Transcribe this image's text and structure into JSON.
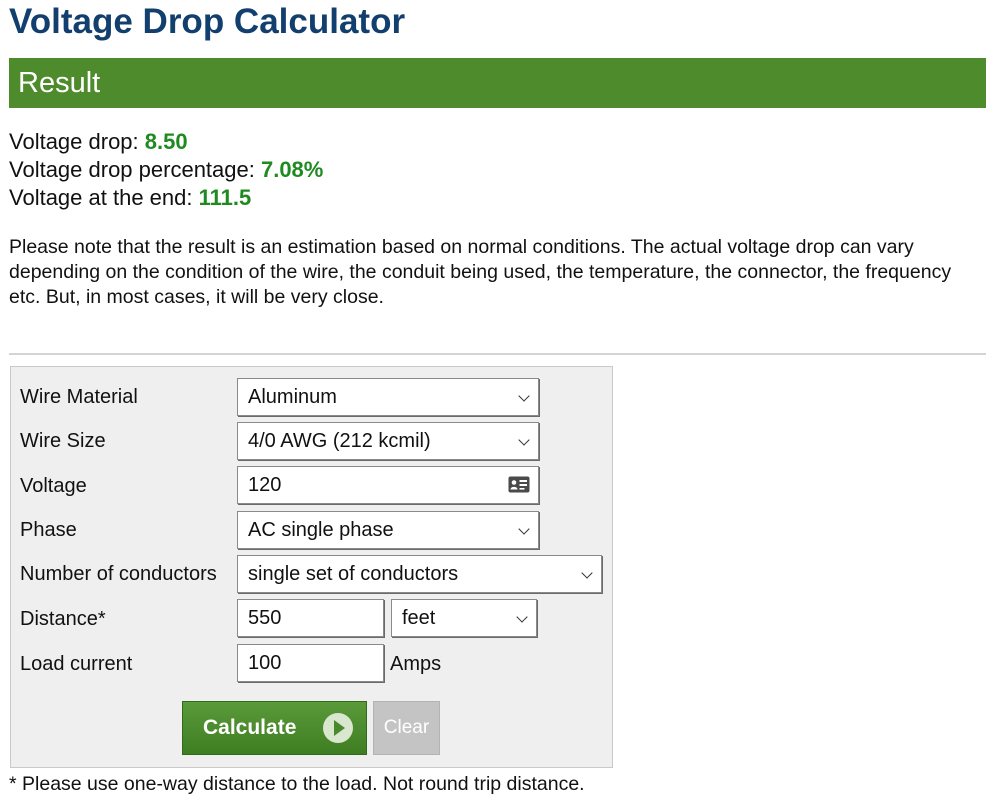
{
  "page": {
    "title": "Voltage Drop Calculator"
  },
  "result": {
    "heading": "Result",
    "lines": [
      {
        "label": "Voltage drop: ",
        "value": "8.50"
      },
      {
        "label": "Voltage drop percentage: ",
        "value": "7.08%"
      },
      {
        "label": "Voltage at the end: ",
        "value": "111.5"
      }
    ],
    "note": "Please note that the result is an estimation based on normal conditions. The actual voltage drop can vary depending on the condition of the wire, the conduit being used, the temperature, the connector, the frequency etc. But, in most cases, it will be very close."
  },
  "form": {
    "wire_material": {
      "label": "Wire Material",
      "value": "Aluminum"
    },
    "wire_size": {
      "label": "Wire Size",
      "value": "4/0 AWG (212 kcmil)"
    },
    "voltage": {
      "label": "Voltage",
      "value": "120"
    },
    "phase": {
      "label": "Phase",
      "value": "AC single phase"
    },
    "conductors": {
      "label": "Number of conductors",
      "value": "single set of conductors"
    },
    "distance": {
      "label": "Distance*",
      "value": "550",
      "unit": "feet"
    },
    "load_current": {
      "label": "Load current",
      "value": "100",
      "unit": "Amps"
    },
    "calculate_label": "Calculate",
    "clear_label": "Clear"
  },
  "footnote": "* Please use one-way distance to the load. Not round trip distance.",
  "colors": {
    "title": "#123f6d",
    "banner": "#4e8b2c",
    "result_value": "#1f8a1f",
    "calculate_button": "#4a8a2c",
    "clear_button": "#c4c4c4"
  }
}
